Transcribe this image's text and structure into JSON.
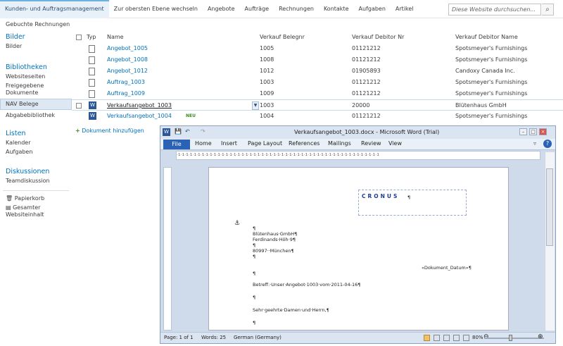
{
  "topnav": {
    "items": [
      "Kunden- und Auftragsmanagement",
      "Zur obersten Ebene wechseln",
      "Angebote",
      "Aufträge",
      "Rechnungen",
      "Kontakte",
      "Aufgaben",
      "Artikel"
    ],
    "search_placeholder": "Diese Website durchsuchen...",
    "search_icon": "search-icon"
  },
  "subnav": {
    "label": "Gebuchte Rechnungen"
  },
  "left": {
    "bilder_header": "Bilder",
    "bilder_item": "Bilder",
    "bibliotheken_header": "Bibliotheken",
    "websiteseiten": "Websiteseiten",
    "freigegebene": "Freigegebene Dokumente",
    "nav_belege": "NAV Belege",
    "abgabebibliothek": "Abgabebibliothek",
    "listen_header": "Listen",
    "kalender": "Kalender",
    "aufgaben": "Aufgaben",
    "diskussionen_header": "Diskussionen",
    "teamdiskussion": "Teamdiskussion",
    "papierkorb": "Papierkorb",
    "gesamter": "Gesamter Websiteinhalt"
  },
  "grid": {
    "headers": {
      "typ": "Typ",
      "name": "Name",
      "belegnr": "Verkauf Belegnr",
      "debitor_nr": "Verkauf Debitor Nr",
      "debitor_name": "Verkauf Debitor Name"
    },
    "rows": [
      {
        "name": "Angebot_1005",
        "belegnr": "1005",
        "debitor_nr": "01121212",
        "debitor_name": "Spotsmeyer's Furnishings"
      },
      {
        "name": "Angebot_1008",
        "belegnr": "1008",
        "debitor_nr": "01121212",
        "debitor_name": "Spotsmeyer's Furnishings"
      },
      {
        "name": "Angebot_1012",
        "belegnr": "1012",
        "debitor_nr": "01905893",
        "debitor_name": "Candoxy Canada Inc."
      },
      {
        "name": "Auftrag_1003",
        "belegnr": "1003",
        "debitor_nr": "01121212",
        "debitor_name": "Spotsmeyer's Furnishings"
      },
      {
        "name": "Auftrag_1009",
        "belegnr": "1009",
        "debitor_nr": "01121212",
        "debitor_name": "Spotsmeyer's Furnishings"
      },
      {
        "name": "Verkaufsangebot_1003",
        "belegnr": "1003",
        "debitor_nr": "20000",
        "debitor_name": "Blütenhaus GmbH"
      },
      {
        "name": "Verkaufsangebot_1004",
        "belegnr": "1004",
        "debitor_nr": "01121212",
        "debitor_name": "Spotsmeyer's Furnishings"
      }
    ],
    "new_badge": "NEU",
    "add_document": "Dokument hinzufügen"
  },
  "word": {
    "title": "Verkaufsangebot_1003.docx - Microsoft Word (Trial)",
    "tabs": [
      "File",
      "Home",
      "Insert",
      "Page Layout",
      "References",
      "Mailings",
      "Review",
      "View"
    ],
    "ruler_text": "·1·1·1·1·1·1·1·1·1·1·1·1·1·1·1·1·1·1·1·1·1·1·1·1·1·1·1·1·1·1·1·1·1·1·1·1·1·1·1·1·1·1·1·1·1·1·1·1·1·1·1",
    "logo_text": "CRONUS",
    "lines": {
      "p1": "¶",
      "addr1": "Blütenhaus·GmbH¶",
      "addr2": "Ferdinands·Höh·9¶",
      "p2": "¶",
      "addr3": "80997··München¶",
      "p3": "¶",
      "datum": "«Dokument_Datum»¶",
      "p4": "¶",
      "betreff": "Betreff:·Unser·Angebot·1003·vom·2011-04-16¶",
      "p5": "¶",
      "anrede": "Sehr·geehrte·Damen·und·Herrn,¶",
      "p6": "¶",
      "logo_pilcrow": "¶"
    },
    "status": {
      "page": "Page: 1 of 1",
      "words": "Words: 25",
      "lang": "German (Germany)",
      "zoom": "80%"
    }
  }
}
